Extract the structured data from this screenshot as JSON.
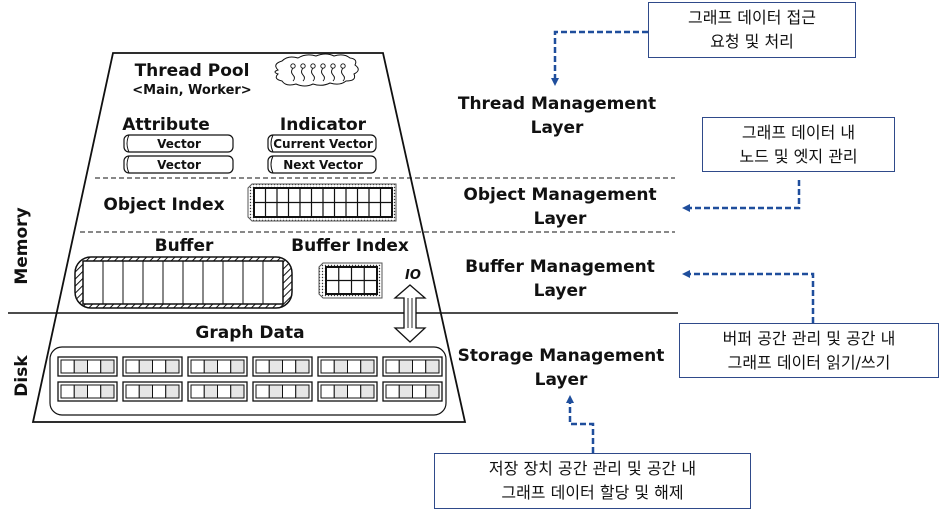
{
  "side_labels": {
    "memory": "Memory",
    "disk": "Disk"
  },
  "thread_layer": {
    "title": "Thread Pool",
    "subtitle": "<Main, Worker>",
    "attribute": {
      "title": "Attribute",
      "items": [
        "Vector",
        "Vector"
      ]
    },
    "indicator": {
      "title": "Indicator",
      "items": [
        "Current Vector",
        "Next Vector"
      ]
    },
    "thread_count": 6
  },
  "object_layer": {
    "title": "Object Index",
    "grid_cols": 12,
    "grid_rows": 2
  },
  "buffer_layer": {
    "buffer_title": "Buffer",
    "buffer_cells": 10,
    "index_title": "Buffer Index",
    "index_cols": 4,
    "index_rows": 2,
    "io_label": "IO"
  },
  "storage_layer": {
    "title": "Graph Data",
    "block_cols": 6,
    "block_rows": 2,
    "cells_per_block": 4
  },
  "layers": [
    {
      "line1": "Thread Management",
      "line2": "Layer"
    },
    {
      "line1": "Object Management",
      "line2": "Layer"
    },
    {
      "line1": "Buffer Management",
      "line2": "Layer"
    },
    {
      "line1": "Storage Management",
      "line2": "Layer"
    }
  ],
  "annotations": [
    {
      "line1": "그래프 데이터 접근",
      "line2": "요청 및 처리"
    },
    {
      "line1": "그래프 데이터 내",
      "line2": "노드 및 엣지 관리"
    },
    {
      "line1": "버퍼 공간 관리 및 공간 내",
      "line2": "그래프 데이터 읽기/쓰기"
    },
    {
      "line1": "저장 장치 공간 관리 및 공간 내",
      "line2": "그래프 데이터 할당 및 해제"
    }
  ],
  "colors": {
    "arrow": "#1f4e9c",
    "box_border": "#2f4a8a",
    "cell_gray": "#e6e6e6",
    "line": "#111111"
  }
}
